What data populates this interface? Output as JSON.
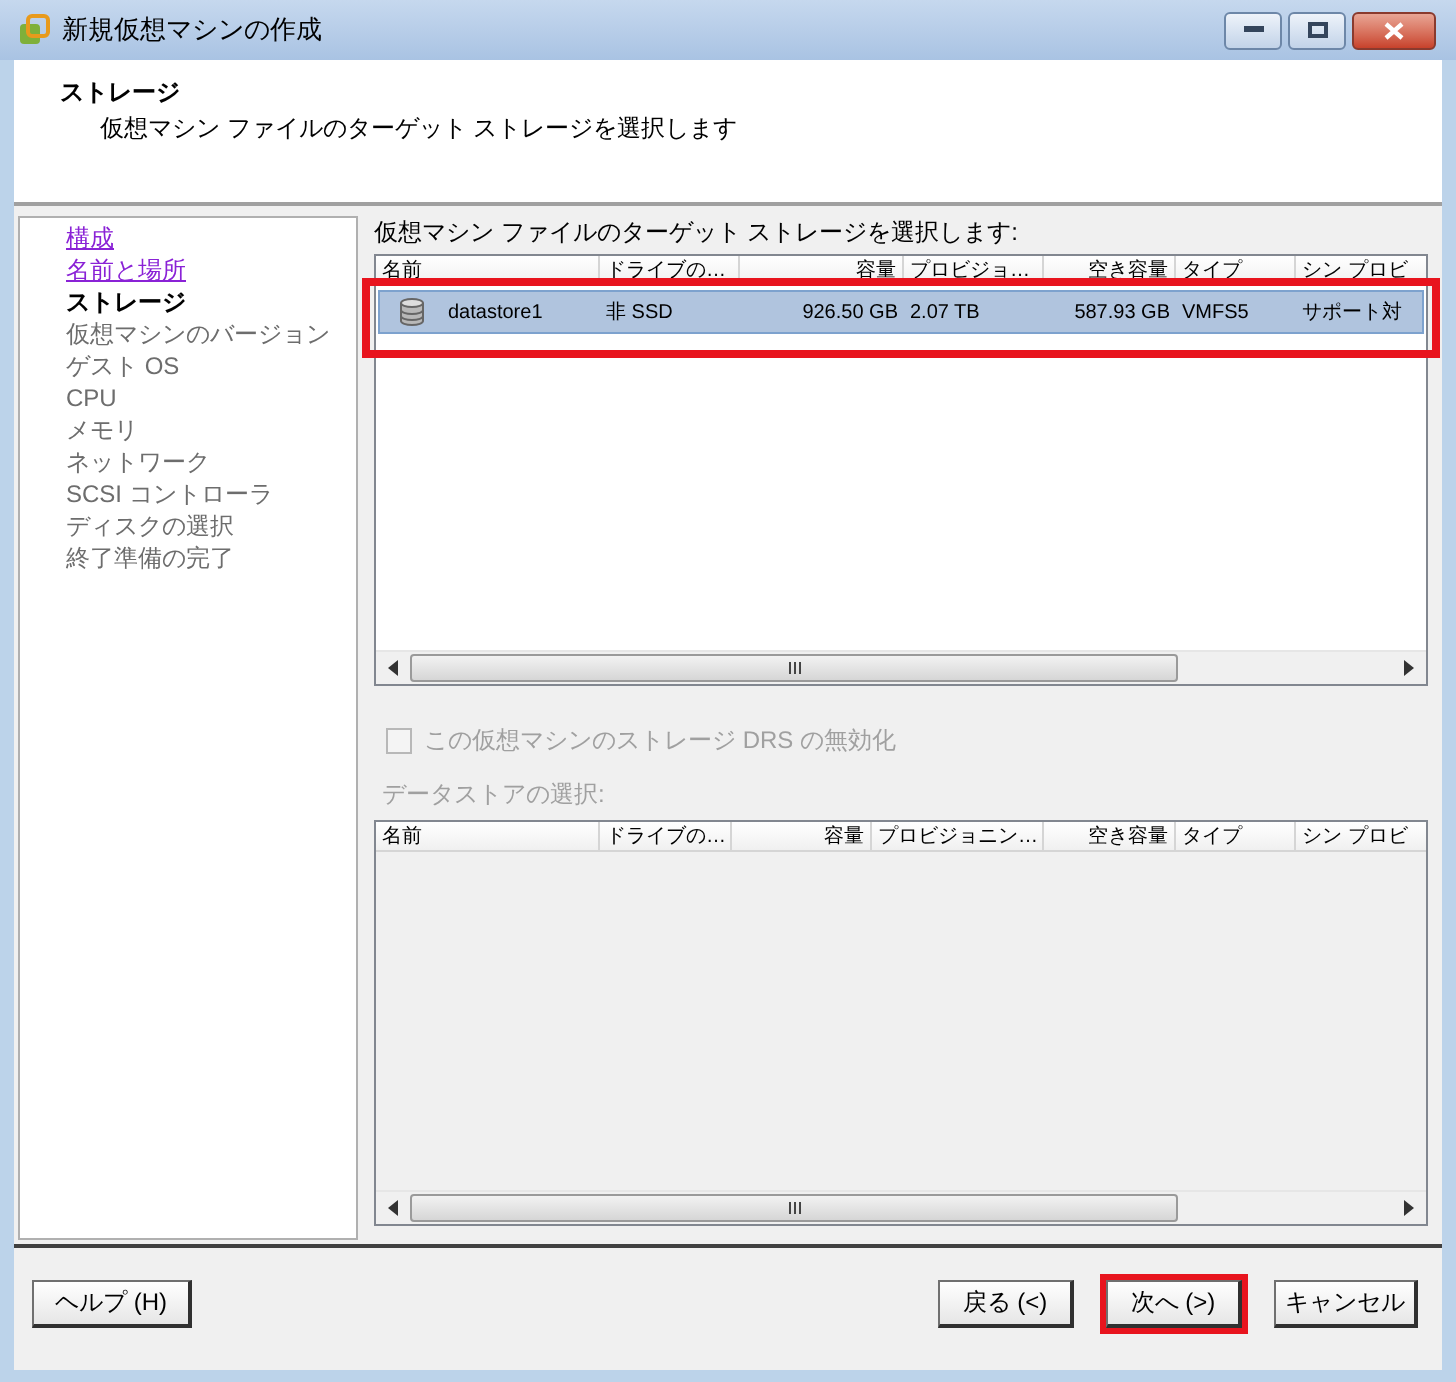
{
  "window": {
    "title": "新規仮想マシンの作成"
  },
  "header": {
    "title": "ストレージ",
    "subtitle": "仮想マシン ファイルのターゲット ストレージを選択します"
  },
  "sidebar": {
    "items": [
      {
        "label": "構成",
        "kind": "visited"
      },
      {
        "label": "名前と場所",
        "kind": "visited"
      },
      {
        "label": "ストレージ",
        "kind": "current"
      },
      {
        "label": "仮想マシンのバージョン",
        "kind": "upcoming"
      },
      {
        "label": "ゲスト OS",
        "kind": "upcoming"
      },
      {
        "label": "CPU",
        "kind": "upcoming"
      },
      {
        "label": "メモリ",
        "kind": "upcoming"
      },
      {
        "label": "ネットワーク",
        "kind": "upcoming"
      },
      {
        "label": "SCSI コントローラ",
        "kind": "upcoming"
      },
      {
        "label": "ディスクの選択",
        "kind": "upcoming"
      },
      {
        "label": "終了準備の完了",
        "kind": "upcoming"
      }
    ]
  },
  "main": {
    "prompt": "仮想マシン ファイルのターゲット ストレージを選択します:",
    "storage_table": {
      "columns": [
        "名前",
        "ドライブの…",
        "容量",
        "プロビジョ…",
        "空き容量",
        "タイプ",
        "シン プロビ"
      ],
      "rows": [
        {
          "cells": [
            "datastore1",
            "非 SSD",
            "926.50 GB",
            "2.07 TB",
            "587.93 GB",
            "VMFS5",
            "サポート対"
          ],
          "selected": true,
          "highlighted": true
        }
      ]
    },
    "disable_drs": {
      "label": "この仮想マシンのストレージ DRS の無効化",
      "checked": false,
      "disabled": true
    },
    "datastore_label": "データストアの選択:",
    "datastore_table": {
      "columns": [
        "名前",
        "ドライブの…",
        "容量",
        "プロビジョニン…",
        "空き容量",
        "タイプ",
        "シン プロビ"
      ]
    }
  },
  "footer": {
    "help": "ヘルプ (H)",
    "buttons": [
      {
        "label": "戻る (<)",
        "highlighted": false
      },
      {
        "label": "次へ (>)",
        "highlighted": true
      },
      {
        "label": "キャンセル",
        "highlighted": false
      }
    ]
  }
}
